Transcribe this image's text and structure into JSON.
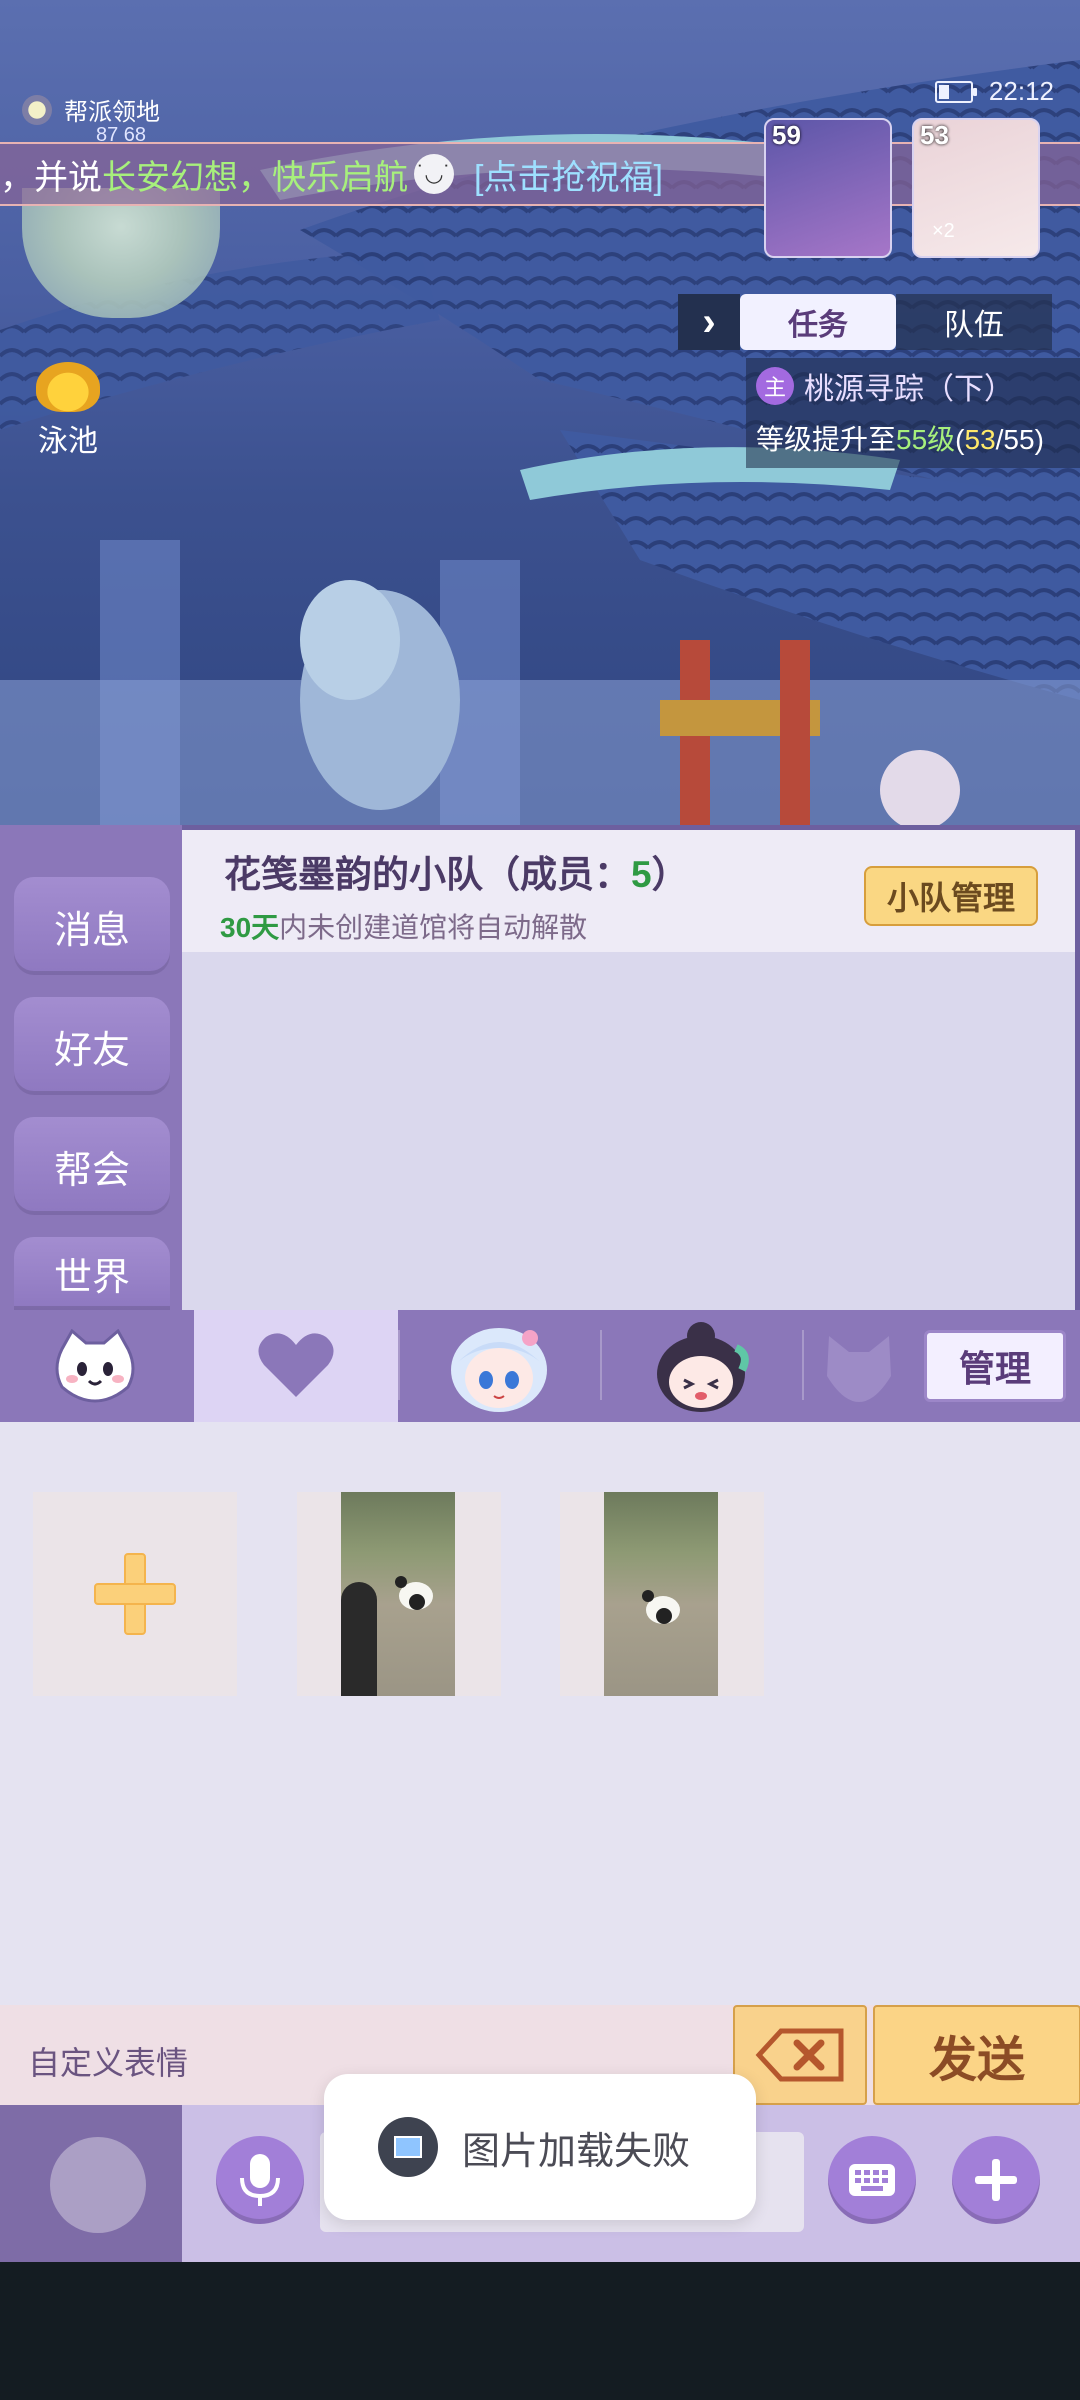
{
  "status": {
    "time": "22:12"
  },
  "top": {
    "guild_label": "帮派领地",
    "coords": "87 68",
    "banner": {
      "prefix": "，并说",
      "green_text": "长安幻想，快乐启航",
      "link": "[点击抢祝福]"
    },
    "pool_label": "泳池",
    "avatars": [
      {
        "level": "59"
      },
      {
        "level": "53",
        "count": "×2"
      }
    ]
  },
  "tasks": {
    "tabs": [
      "任务",
      "队伍"
    ],
    "badge": "主",
    "title": "桃源寻踪（下）",
    "desc_prefix": "等级提升至",
    "desc_level": "55级",
    "desc_open": "(",
    "desc_current": "53",
    "desc_rest": "/55)"
  },
  "sidebar": {
    "items": [
      "消息",
      "好友",
      "帮会",
      "世界"
    ]
  },
  "team": {
    "title_prefix": "花笺墨韵的小队（成员：",
    "member_count": "5",
    "title_suffix": "）",
    "note_days": "30天",
    "note_rest": "内未创建道馆将自动解散",
    "manage_label": "小队管理"
  },
  "sticker_tabs": {
    "manage_label": "管理",
    "icons": [
      "cat-face-icon",
      "heart-icon",
      "girl-avatar-icon",
      "bun-girl-avatar-icon",
      "fox-mask-icon"
    ]
  },
  "stickers": {
    "items": [
      "add-sticker",
      "panda-photo-1",
      "panda-photo-2"
    ]
  },
  "bottom": {
    "custom_label": "自定义表情",
    "send_label": "发送"
  },
  "toast": {
    "text": "图片加载失败"
  },
  "colors": {
    "panel": "#8b77b9",
    "accent_gold": "#fbd486",
    "green": "#2f9a43"
  }
}
